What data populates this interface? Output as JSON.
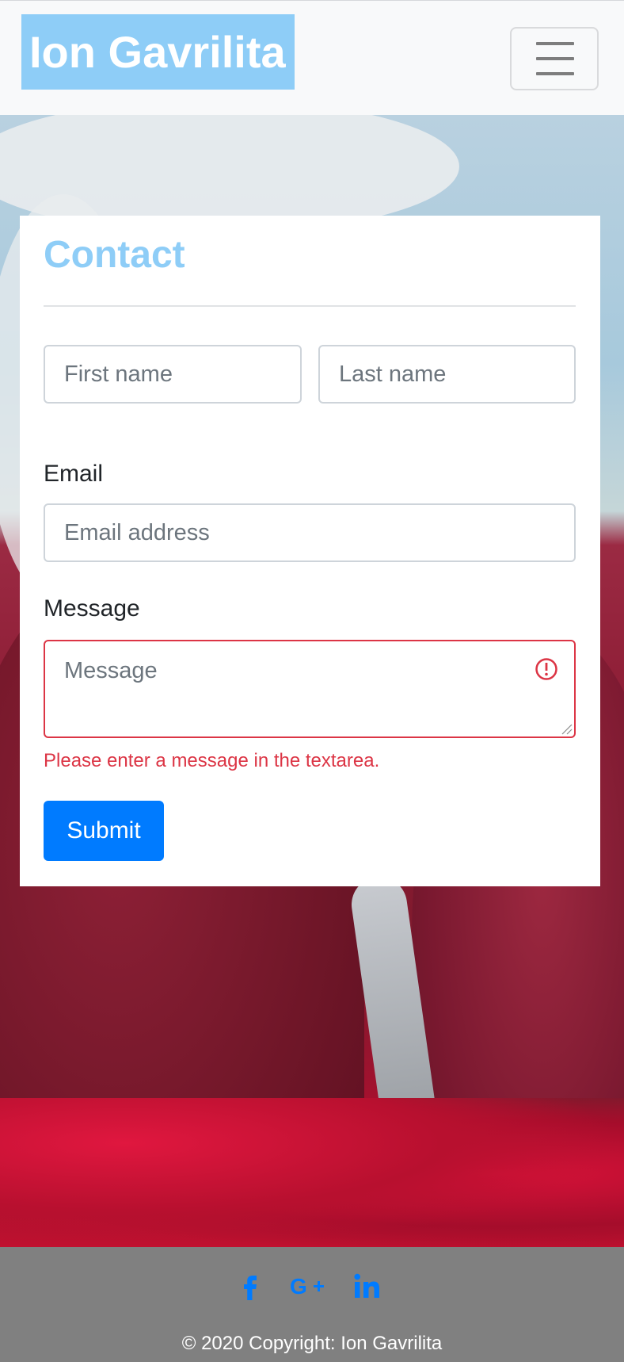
{
  "navbar": {
    "brand": "Ion Gavrilita",
    "toggler_icon": "hamburger-menu-icon"
  },
  "contact": {
    "title": "Contact",
    "first_name": {
      "placeholder": "First name",
      "value": ""
    },
    "last_name": {
      "placeholder": "Last name",
      "value": ""
    },
    "email": {
      "label": "Email",
      "placeholder": "Email address",
      "value": ""
    },
    "message": {
      "label": "Message",
      "placeholder": "Message",
      "value": "",
      "invalid": true,
      "error": "Please enter a message in the textarea."
    },
    "submit_label": "Submit"
  },
  "footer": {
    "social": [
      {
        "icon": "facebook-icon",
        "glyph": "f"
      },
      {
        "icon": "google-plus-icon",
        "glyph": "G+"
      },
      {
        "icon": "linkedin-icon",
        "glyph": "in"
      }
    ],
    "copyright": "© 2020 Copyright: Ion Gavrilita"
  },
  "colors": {
    "brand_bg": "#8ecdf7",
    "title": "#8ecdf7",
    "primary": "#007bff",
    "danger": "#dc3545",
    "footer_bg": "#808080",
    "social_icon": "#007bff"
  }
}
